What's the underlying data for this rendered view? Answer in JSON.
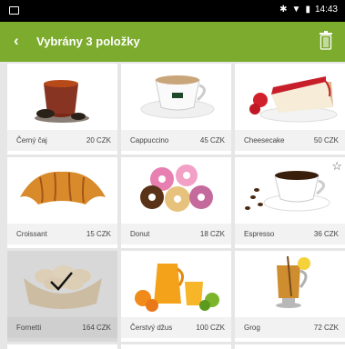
{
  "statusbar": {
    "time": "14:43"
  },
  "appbar": {
    "back": "‹",
    "title": "Vybrány 3 položky"
  },
  "colors": {
    "accent": "#7cab2e"
  },
  "items": [
    {
      "name": "Černý čaj",
      "price": "20 CZK"
    },
    {
      "name": "Cappuccino",
      "price": "45 CZK"
    },
    {
      "name": "Cheesecake",
      "price": "50 CZK"
    },
    {
      "name": "Croissant",
      "price": "15 CZK"
    },
    {
      "name": "Donut",
      "price": "18 CZK"
    },
    {
      "name": "Espresso",
      "price": "36 CZK"
    },
    {
      "name": "Fornetti",
      "price": "164 CZK"
    },
    {
      "name": "Čerstvý džus",
      "price": "100 CZK"
    },
    {
      "name": "Grog",
      "price": "72 CZK"
    }
  ]
}
